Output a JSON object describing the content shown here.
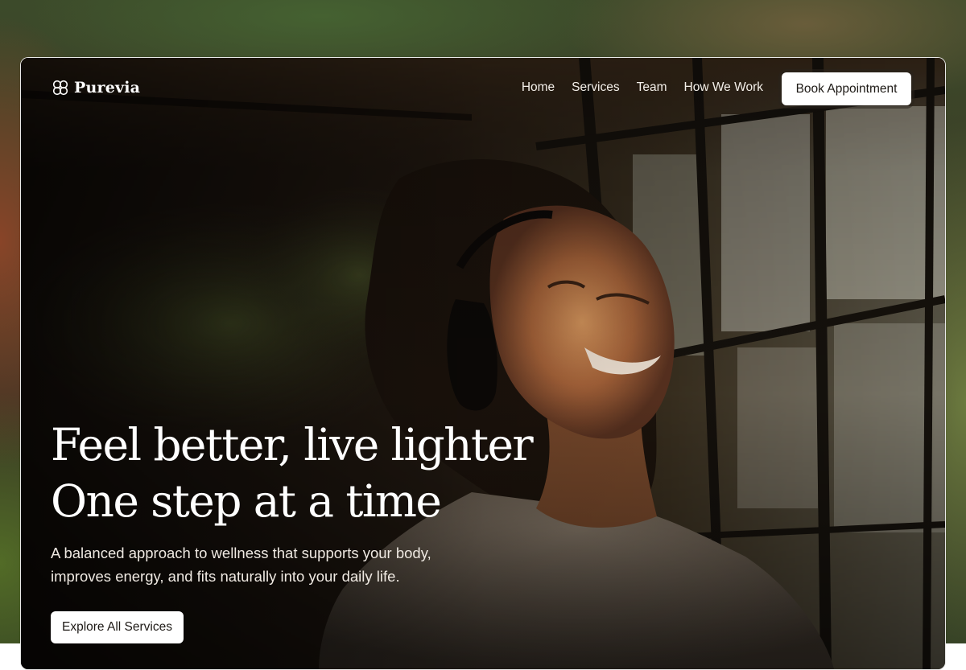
{
  "brand": {
    "name": "Purevia",
    "logo_icon": "flower-icon"
  },
  "nav": {
    "links": [
      "Home",
      "Services",
      "Team",
      "How We Work"
    ],
    "cta_label": "Book Appointment"
  },
  "hero": {
    "title_line1": "Feel better, live lighter",
    "title_line2": "One step at a time",
    "subtitle_line1": "A balanced approach to wellness that supports your body,",
    "subtitle_line2": "improves energy, and fits naturally into your daily life.",
    "button_label": "Explore All Services",
    "photo": "woman-with-headphones-photo"
  },
  "colors": {
    "text_light": "#ffffff",
    "button_bg": "#ffffff",
    "button_text": "#1e1a16",
    "frame_border": "#ffffff"
  }
}
